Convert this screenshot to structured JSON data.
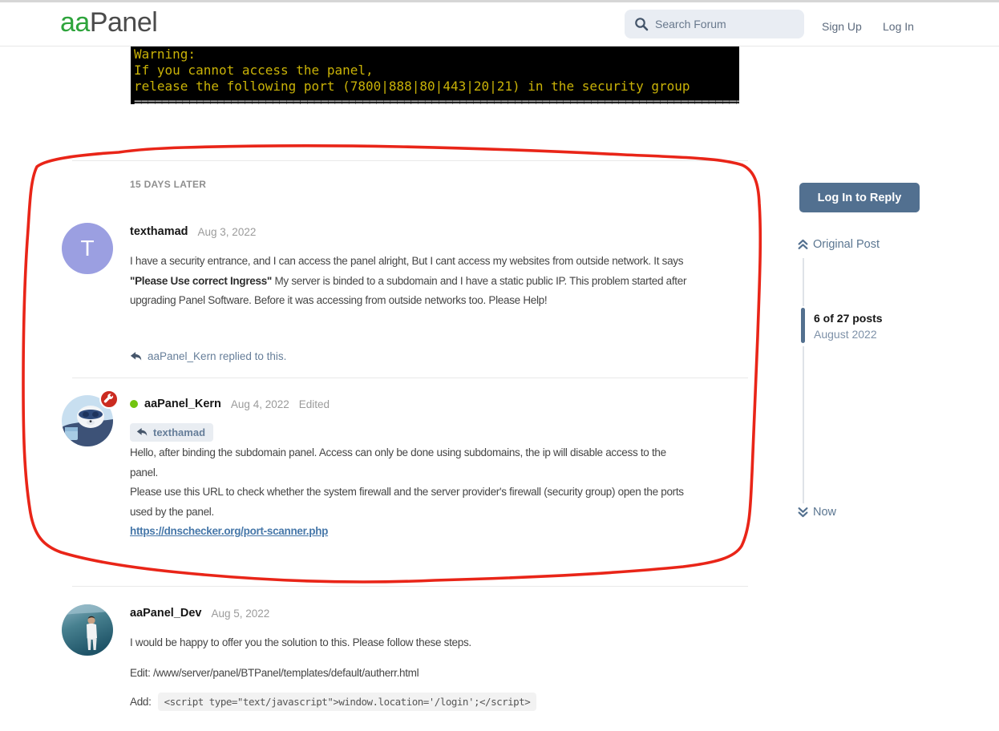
{
  "header": {
    "logo_part1": "aa",
    "logo_part2": "Panel",
    "search_placeholder": "Search Forum",
    "sign_up": "Sign Up",
    "log_in": "Log In"
  },
  "terminal": {
    "line1": "Warning:",
    "line2": "If you cannot access the panel,",
    "line3": "release the following port (7800|888|80|443|20|21) in the security group",
    "separator": "=========================================================================================="
  },
  "thread": {
    "time_gap_label": "15 DAYS LATER",
    "posts": [
      {
        "author": "texthamad",
        "date": "Aug 3, 2022",
        "avatar_letter": "T",
        "line1": "I have a security entrance, and I can access the panel alright, But I cant access my websites from outside network. It says",
        "line2_bold": "\"Please Use correct Ingress\"",
        "line2_rest": " My server is binded to a subdomain and I have a static public IP. This problem started after",
        "line3": "upgrading Panel Software. Before it was accessing from outside networks too. Please Help!",
        "reply_note": "aaPanel_Kern replied to this."
      },
      {
        "author": "aaPanel_Kern",
        "date": "Aug 4, 2022",
        "edited_label": "Edited",
        "reply_to": "texthamad",
        "line1": "Hello, after binding the subdomain panel. Access can only be done using subdomains, the ip will disable access to the",
        "line2": "panel.",
        "line3": "Please use this URL to check whether the system firewall and the server provider's firewall (security group) open the ports",
        "line4": "used by the panel.",
        "link": "https://dnschecker.org/port-scanner.php"
      },
      {
        "author": "aaPanel_Dev",
        "date": "Aug 5, 2022",
        "line1": "I would be happy to offer you the solution to this. Please follow these steps.",
        "line2": "Edit: /www/server/panel/BTPanel/templates/default/autherr.html",
        "add_prefix": "Add:",
        "code": "<script type=\"text/javascript\">window.location='/login';</script>"
      }
    ]
  },
  "sidebar": {
    "reply_button": "Log In to Reply",
    "original_post": "Original Post",
    "scrubber_position": "6 of 27 posts",
    "scrubber_period": "August 2022",
    "now": "Now"
  },
  "colors": {
    "logo_green": "#2ea43c",
    "terminal_text": "#c9b207",
    "avatar_purple": "#9b9fe1",
    "online_dot": "#72c40f",
    "badge_red": "#cb2b20",
    "button_slate": "#527090",
    "link_blue": "#4677a9",
    "annotation_red": "#e8190c"
  }
}
